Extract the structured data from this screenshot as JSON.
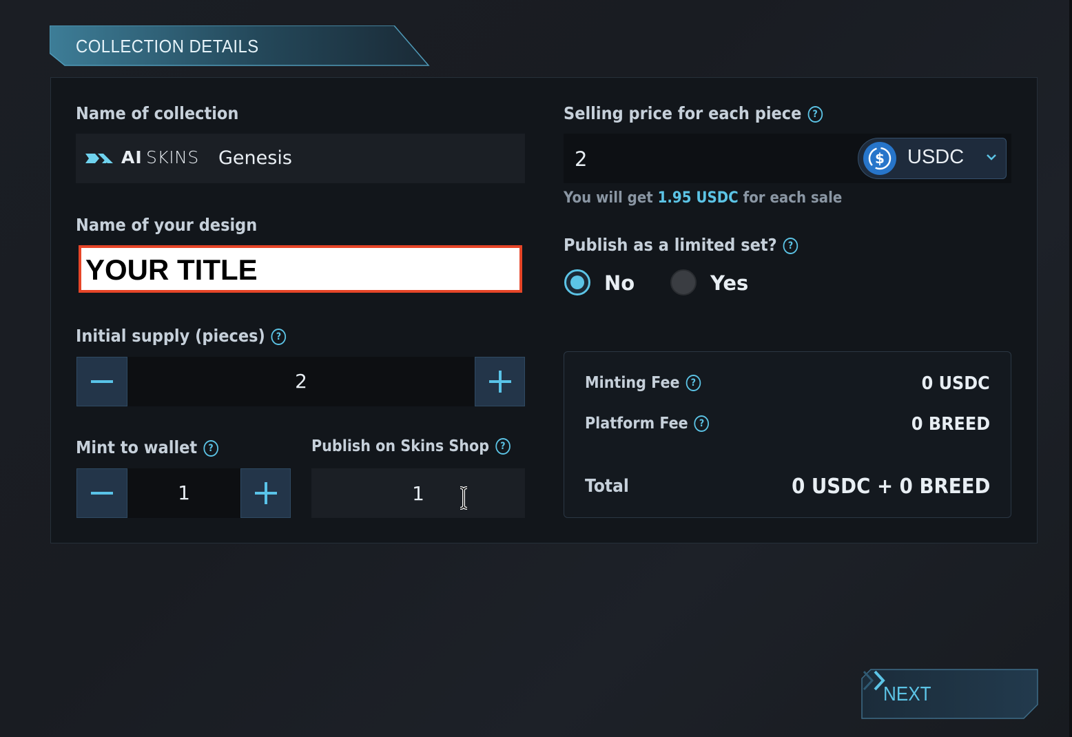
{
  "header": {
    "title": "COLLECTION DETAILS"
  },
  "collection": {
    "label": "Name of collection",
    "brand_ai": "AI",
    "brand_skins": "SKINS",
    "value": "Genesis"
  },
  "design": {
    "label": "Name of your design",
    "value": "YOUR TITLE"
  },
  "supply": {
    "label": "Initial supply (pieces)",
    "value": "2",
    "minus": "−",
    "plus": "+"
  },
  "mint": {
    "label": "Mint to wallet",
    "value": "1"
  },
  "publish_shop": {
    "label": "Publish on Skins Shop",
    "value": "1"
  },
  "price": {
    "label": "Selling price for each piece",
    "value": "2",
    "currency": "USDC",
    "hint_prefix": "You will get",
    "hint_amount": "1.95 USDC",
    "hint_suffix": "for each sale"
  },
  "limited_set": {
    "label": "Publish as a limited set?",
    "options": [
      "No",
      "Yes"
    ],
    "selected": "No"
  },
  "fees": {
    "minting_label": "Minting Fee",
    "minting_value": "0 USDC",
    "platform_label": "Platform Fee",
    "platform_value": "0 BREED",
    "total_label": "Total",
    "total_value": "0 USDC + 0 BREED"
  },
  "next": {
    "label": "NEXT"
  },
  "icons": {
    "help": "help-circle-icon",
    "usdc": "usdc-coin-icon",
    "chevron": "chevron-down-icon",
    "next": "double-chevron-right-icon",
    "cursor": "text-cursor-icon"
  },
  "colors": {
    "accent": "#5cc4e6",
    "highlight_border": "#e64528",
    "panel": "#12161b",
    "background": "#1b1e24"
  }
}
